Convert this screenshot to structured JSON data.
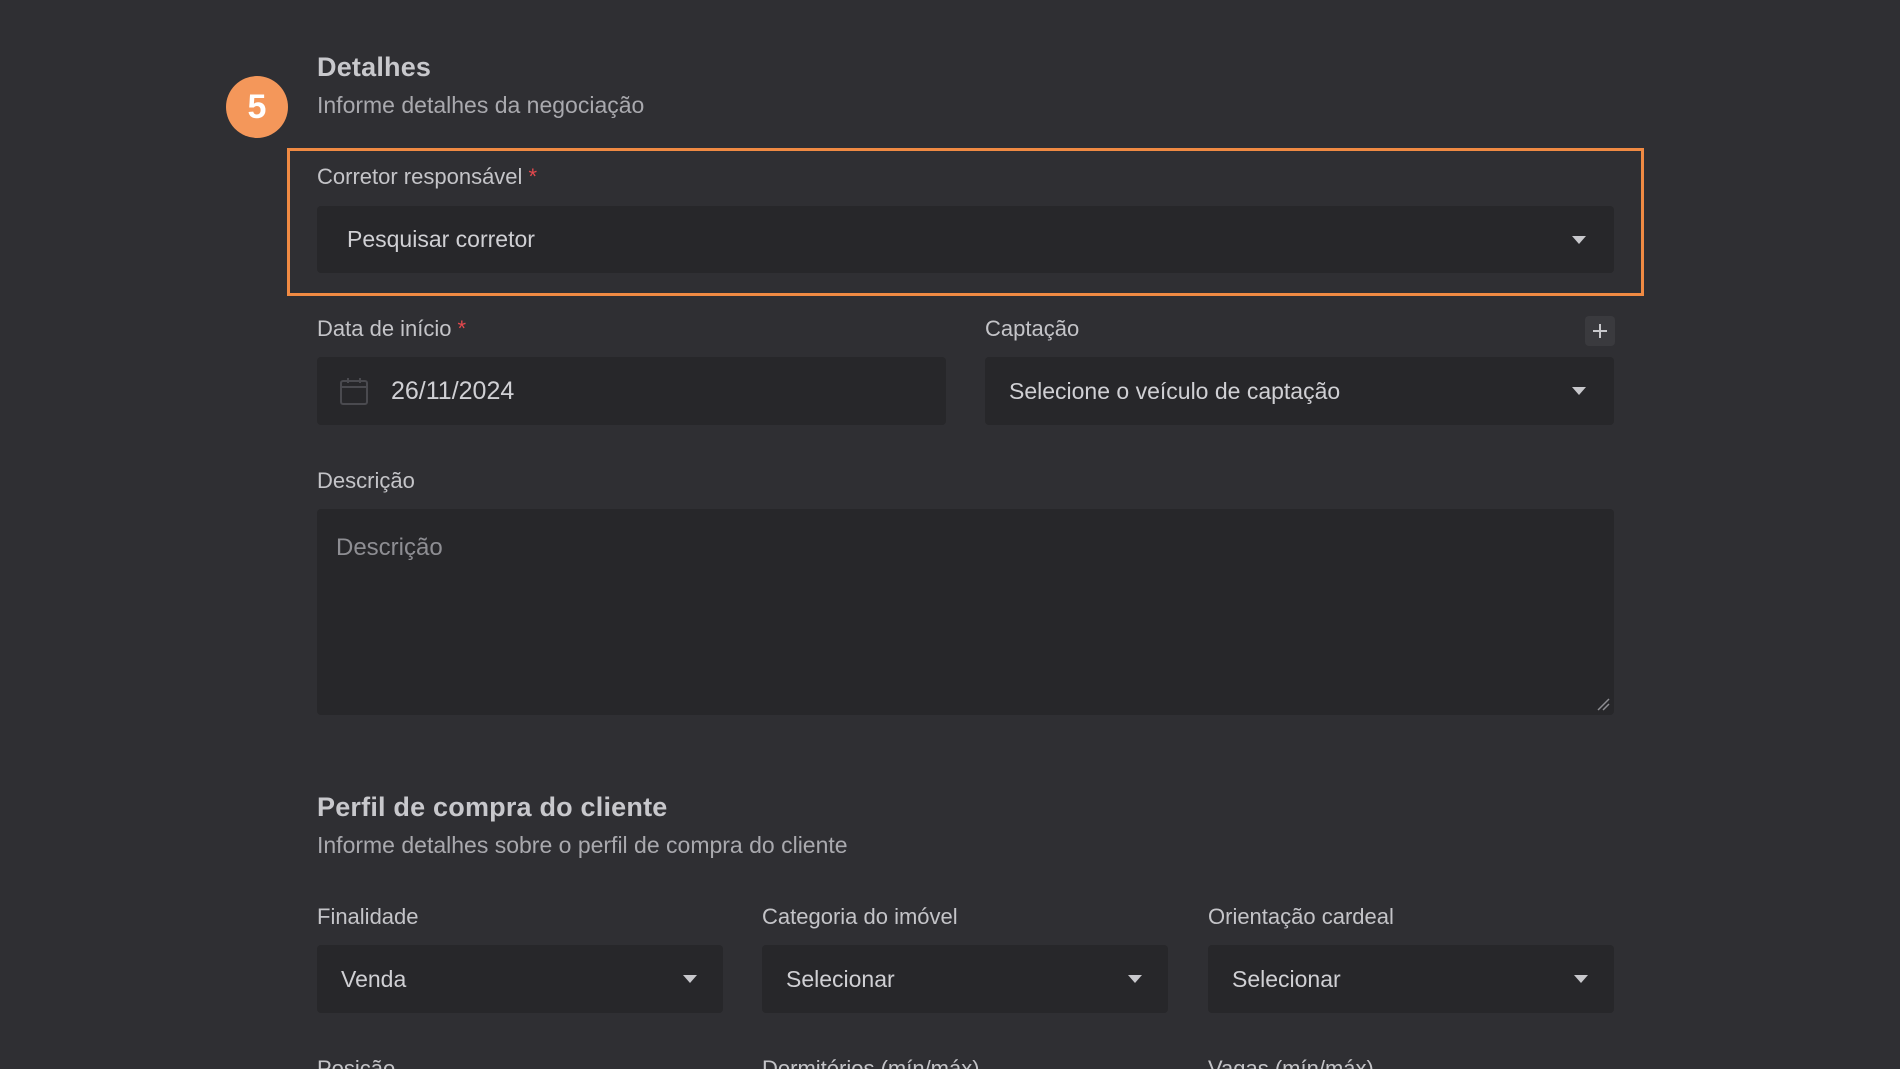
{
  "step": {
    "number": "5"
  },
  "details": {
    "title": "Detalhes",
    "subtitle": "Informe detalhes da negociação",
    "broker": {
      "label": "Corretor responsável",
      "required_mark": "*",
      "placeholder": "Pesquisar corretor"
    },
    "start_date": {
      "label": "Data de início",
      "required_mark": "*",
      "value": "26/11/2024"
    },
    "capture": {
      "label": "Captação",
      "placeholder": "Selecione o veículo de captação"
    },
    "description": {
      "label": "Descrição",
      "placeholder": "Descrição"
    }
  },
  "profile": {
    "title": "Perfil de compra do cliente",
    "subtitle": "Informe detalhes sobre o perfil de compra do cliente",
    "purpose": {
      "label": "Finalidade",
      "value": "Venda"
    },
    "category": {
      "label": "Categoria do imóvel",
      "value": "Selecionar"
    },
    "orientation": {
      "label": "Orientação cardeal",
      "value": "Selecionar"
    },
    "next_labels": [
      "Posição",
      "Dormitórios (mín/máx)",
      "Vagas (mín/máx)"
    ]
  },
  "colors": {
    "background": "#2f2f33",
    "field": "#27272a",
    "accent": "#f08a43",
    "badge": "#f4975a",
    "required": "#e5484d"
  }
}
